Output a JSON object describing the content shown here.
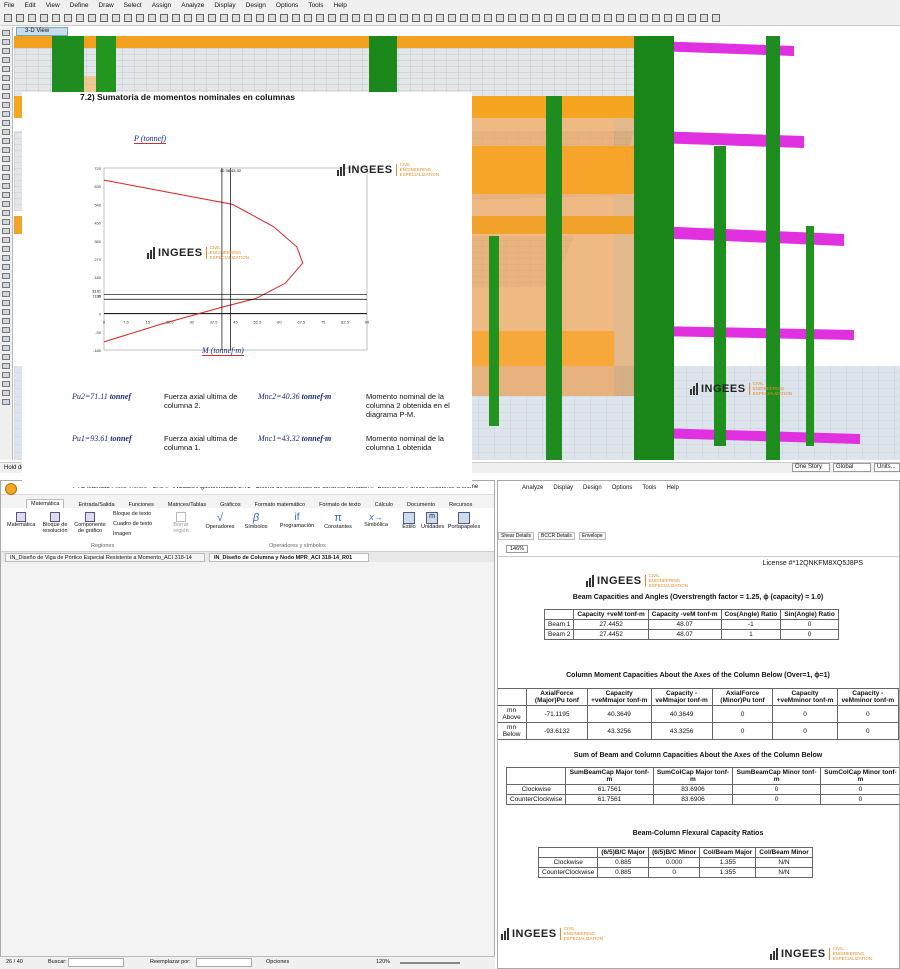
{
  "etabs": {
    "menu": [
      "File",
      "Edit",
      "View",
      "Define",
      "Draw",
      "Select",
      "Assign",
      "Analyze",
      "Display",
      "Design",
      "Options",
      "Tools",
      "Help"
    ],
    "view_tab": "3-D View",
    "status": "Hold down left mouse button and drag to walk region",
    "story": "One Story",
    "coord": "Global",
    "units": "Units..."
  },
  "logo": {
    "name": "INGEES",
    "tagline": "CIVIL ENGINEERING ESPECIALIZATION"
  },
  "mathcad": {
    "title": "PTC Mathcad Prime 7.0.0.0 - G:\\04.- INGEES\\Agosto\\Modulo 2\\T1 - Diseño de elementos de concreto armado\\4.- Diseño de Portico Resistente a Mome",
    "ribbon_tabs": [
      "Matemática",
      "Entrada/Salida",
      "Funciones",
      "Matrices/Tablas",
      "Gráficos",
      "Formato matemático",
      "Formato de texto",
      "Cálculo",
      "Documento",
      "Recursos"
    ],
    "ribbon": {
      "matematica": "Matemática",
      "bloque": "Bloque de resolución",
      "componente": "Componente de gráfico",
      "bloque_texto": "Bloque de texto",
      "cuadro_texto": "Cuadro de texto",
      "imagen": "Imagen",
      "borrar": "Borrar región",
      "regiones": "Regiones",
      "operadores": "Operadores",
      "simbolos": "Símbolos",
      "programacion": "Programación",
      "constantes": "Constantes",
      "simbolica": "Simbólica",
      "ops_group": "Operadores y símbolos",
      "estilo": "Estilo",
      "unidades": "Unidades",
      "portapapeles": "Portapapeles"
    },
    "doc_tabs": [
      "IN_Diseño de Viga de Pórtico Especial Resistente a Momento_ACI 318-14",
      "IN_Diseño de Columna y Nodo MPR_ACI 318-14_R01"
    ],
    "heading": "7.2) Sumatoria de momentos nominales en columnas",
    "p_label": "P  (tonnef)",
    "m_label": "M  (tonnef·m)",
    "eq1": {
      "sym": "Pu2",
      "val": "=71.11",
      "unit": "tonnef",
      "desc": "Fuerza axial ultima de columna 2.",
      "msym": "Mnc2",
      "mval": "=40.36",
      "munit": "tonnef·m",
      "mdesc": "Momento nominal de la columna 2 obtenida en el diagrama P-M."
    },
    "eq2": {
      "sym": "Pu1",
      "val": "=93.61",
      "unit": "tonnef",
      "desc": "Fuerza axial ultima de columna 1.",
      "msym": "Mnc1",
      "mval": "=43.32",
      "munit": "tonnef·m",
      "mdesc": "Momento nominal de la columna 1 obtenida"
    },
    "page_num": "26 / 40",
    "buscar": "Buscar:",
    "reemplazar": "Reemplazar por:",
    "opciones": "Opciones",
    "zoom": "120%"
  },
  "chart_data": {
    "type": "line",
    "title": "",
    "xlabel": "M (tonnef·m)",
    "ylabel": "P (tonnef)",
    "x_ticks": [
      "0",
      "7.5",
      "15",
      "22.5",
      "30",
      "37.5",
      "45",
      "52.5",
      "60",
      "67.5",
      "75",
      "82.5",
      "90"
    ],
    "y_ticks": [
      "720",
      "630",
      "540",
      "450",
      "360",
      "270",
      "180",
      "90",
      "0",
      "-90",
      "-180"
    ],
    "xlim": [
      0,
      90
    ],
    "ylim": [
      -180,
      720
    ],
    "series": [
      {
        "x": [
          0,
          44,
          58,
          66,
          68,
          62,
          52,
          40,
          20,
          0
        ],
        "y": [
          660,
          540,
          430,
          330,
          250,
          150,
          75,
          30,
          -50,
          -140
        ]
      }
    ],
    "markers": {
      "x1": 40.36,
      "x2": 43.32,
      "y1": 71.11,
      "y2": 93.61
    },
    "marker_labels": [
      "40.36",
      "43.32"
    ],
    "side_labels": [
      "93.61",
      "71.11"
    ]
  },
  "bcb": {
    "menu": [
      "Analyze",
      "Display",
      "Design",
      "Options",
      "Tools",
      "Help"
    ],
    "tabs": [
      "Shear Details",
      "BCCR Details",
      "Envelope"
    ],
    "zoom": "146%",
    "license": "License #*12QNKFM8XQ5J8PS",
    "t1": {
      "title": "Beam Capacities and Angles (Overstrength factor = 1.25, ϕ (capacity) = 1.0)",
      "headers": [
        "",
        "Capacity +veM tonf-m",
        "Capacity -veM tonf-m",
        "Cos(Angle) Ratio",
        "Sin(Angle) Ratio"
      ],
      "rows": [
        [
          "Beam 1",
          "27.4452",
          "48.07",
          "-1",
          "0"
        ],
        [
          "Beam 2",
          "27.4452",
          "48.07",
          "1",
          "0"
        ]
      ]
    },
    "t2": {
      "title": "Column Moment Capacities About the Axes of the Column Below (Over=1, ϕ=1)",
      "headers": [
        "",
        "AxialForce (Major)Pu tonf",
        "Capacity +veMmajor tonf-m",
        "Capacity -veMmajor tonf-m",
        "AxialForce (Minor)Pu tonf",
        "Capacity +veMminor tonf-m",
        "Capacity -veMminor tonf-m"
      ],
      "rows": [
        [
          "mn Above",
          "-71.1195",
          "40.3649",
          "40.3649",
          "0",
          "0",
          "0"
        ],
        [
          "mn Below",
          "-93.6132",
          "43.3256",
          "43.3256",
          "0",
          "0",
          "0"
        ]
      ]
    },
    "t3": {
      "title": "Sum of Beam and Column Capacities About the Axes of the Column Below",
      "headers": [
        "",
        "SumBeamCap Major tonf-m",
        "SumColCap Major tonf-m",
        "SumBeamCap Minor tonf-m",
        "SumColCap Minor tonf-m"
      ],
      "rows": [
        [
          "Clockwise",
          "61.7561",
          "83.6906",
          "0",
          "0"
        ],
        [
          "CounterClockwise",
          "61.7561",
          "83.6906",
          "0",
          "0"
        ]
      ]
    },
    "t4": {
      "title": "Beam-Column Flexural Capacity Ratios",
      "headers": [
        "",
        "(6/5)B/C Major",
        "(6/5)B/C Minor",
        "Col/Beam Major",
        "Col/Beam Minor"
      ],
      "rows": [
        [
          "Clockwise",
          "0.885",
          "0.000",
          "1.355",
          "N/N"
        ],
        [
          "CounterClockwise",
          "0.885",
          "0",
          "1.355",
          "N/N"
        ]
      ]
    }
  }
}
